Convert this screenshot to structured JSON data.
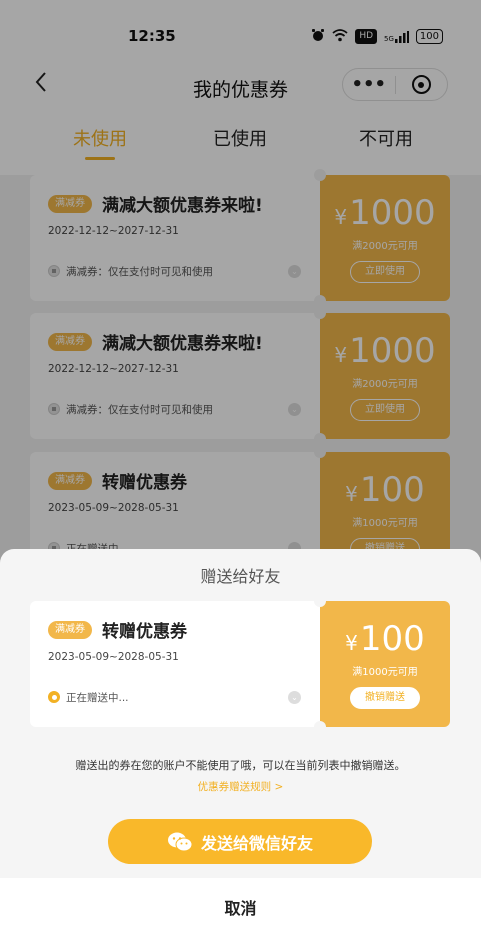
{
  "status_bar": {
    "time": "12:35",
    "icons": [
      "alarm-icon",
      "wifi-icon",
      "hd-icon",
      "signal-icon",
      "battery-icon"
    ],
    "hd_label": "HD",
    "signal_label": "5G",
    "battery": "100"
  },
  "nav": {
    "back_icon": "chevron-left-icon",
    "title": "我的优惠券",
    "more_label": "•••"
  },
  "tabs": [
    {
      "label": "未使用",
      "active": true
    },
    {
      "label": "已使用",
      "active": false
    },
    {
      "label": "不可用",
      "active": false
    }
  ],
  "coupons": [
    {
      "badge": "满减券",
      "title": "满减大额优惠券来啦!",
      "date": "2022-12-12~2027-12-31",
      "desc": "满减券：仅在支付时可见和使用",
      "currency": "¥",
      "amount": "1000",
      "condition": "满2000元可用",
      "button": "立即使用"
    },
    {
      "badge": "满减券",
      "title": "满减大额优惠券来啦!",
      "date": "2022-12-12~2027-12-31",
      "desc": "满减券：仅在支付时可见和使用",
      "currency": "¥",
      "amount": "1000",
      "condition": "满2000元可用",
      "button": "立即使用"
    },
    {
      "badge": "满减券",
      "title": "转赠优惠券",
      "date": "2023-05-09~2028-05-31",
      "desc": "正在赠送中",
      "currency": "¥",
      "amount": "100",
      "condition": "满1000元可用",
      "button": "撤销赠送"
    }
  ],
  "sheet": {
    "title": "赠送给好友",
    "coupon": {
      "badge": "满减券",
      "title": "转赠优惠券",
      "date": "2023-05-09~2028-05-31",
      "desc": "正在赠送中...",
      "currency": "¥",
      "amount": "100",
      "condition": "满1000元可用",
      "button": "撤销赠送"
    },
    "notice": "赠送出的券在您的账户不能使用了哦，可以在当前列表中撤销赠送。",
    "rules_link": "优惠券赠送规则 >",
    "send_button": "发送给微信好友",
    "cancel": "取消"
  },
  "colors": {
    "accent": "#f2b124",
    "coupon_right": "#f2b74a",
    "send_button": "#f9b82a",
    "overlay": "rgba(0,0,0,0.35)"
  }
}
